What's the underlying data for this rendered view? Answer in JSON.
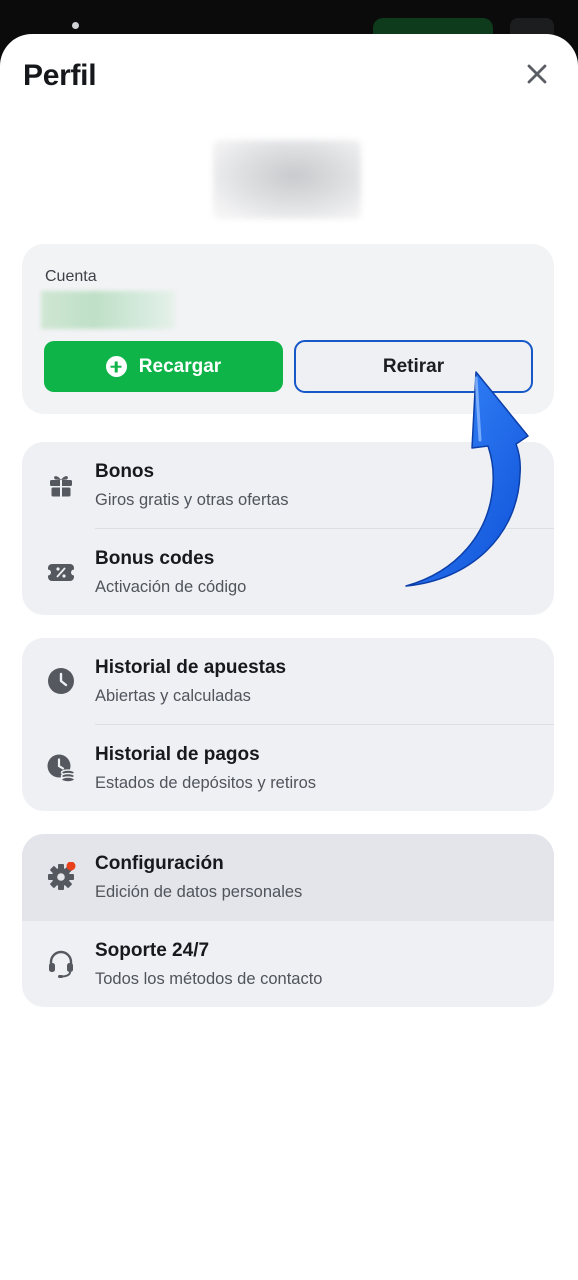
{
  "header": {
    "title": "Perfil",
    "close_icon": "close-icon"
  },
  "account": {
    "label": "Cuenta",
    "recharge_label": "Recargar",
    "withdraw_label": "Retirar"
  },
  "groups": [
    {
      "items": [
        {
          "title": "Bonos",
          "subtitle": "Giros gratis y otras ofertas",
          "icon": "gift-icon"
        },
        {
          "title": "Bonus codes",
          "subtitle": "Activación de código",
          "icon": "promo-ticket-icon"
        }
      ]
    },
    {
      "items": [
        {
          "title": "Historial de apuestas",
          "subtitle": "Abiertas y calculadas",
          "icon": "clock-icon"
        },
        {
          "title": "Historial de pagos",
          "subtitle": "Estados de depósitos y retiros",
          "icon": "payment-history-icon"
        }
      ]
    },
    {
      "items": [
        {
          "title": "Configuración",
          "subtitle": "Edición de datos personales",
          "icon": "gear-icon",
          "notification_dot": true
        },
        {
          "title": "Soporte 24/7",
          "subtitle": "Todos los métodos de contacto",
          "icon": "headset-icon"
        }
      ]
    }
  ],
  "colors": {
    "primary_green": "#0fb449",
    "highlight_blue": "#1758c9",
    "notification_red": "#e8411c",
    "icon_gray": "#55595f"
  }
}
